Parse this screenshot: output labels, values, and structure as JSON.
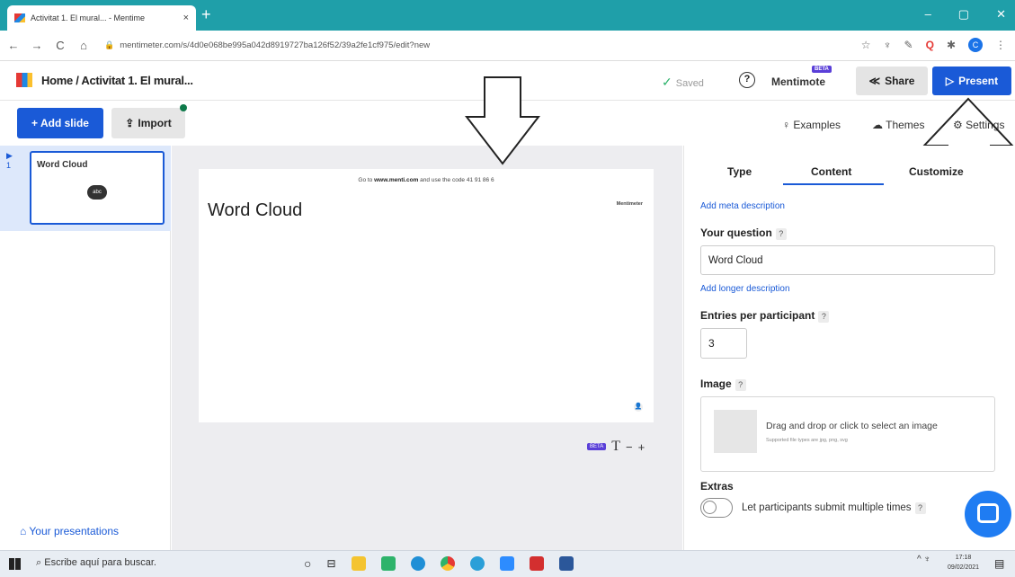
{
  "browser": {
    "tab_title": "Activitat 1. El mural... - Mentime",
    "tab_close": "×",
    "new_tab": "+",
    "window_controls": [
      "–",
      "▢",
      "✕"
    ],
    "nav": [
      "←",
      "→",
      "C",
      "⌂"
    ],
    "url": "mentimeter.com/s/4d0e068be995a042d8919727ba126f52/39a2fe1cf975/edit?new",
    "ext_icons": [
      "☆",
      "♆",
      "✎",
      "Q",
      "✱"
    ],
    "profile_initial": "C"
  },
  "header": {
    "breadcrumb": "Home / Activitat 1. El mural...",
    "saved": "Saved",
    "mentimote": "Mentimote",
    "mentimote_badge": "BETA",
    "share": "Share",
    "present": "Present"
  },
  "toolbar": {
    "add_slide": "+ Add slide",
    "import": "Import",
    "examples": "Examples",
    "themes": "Themes",
    "settings": "Settings"
  },
  "slides": [
    {
      "number": "1",
      "title": "Word Cloud"
    }
  ],
  "your_presentations": "Your presentations",
  "canvas": {
    "code_prefix": "Go to",
    "code_site": "www.menti.com",
    "code_mid": "and use the code",
    "code": "41 91 86 6",
    "title": "Word Cloud",
    "logo": "Mentimeter",
    "zoom_badge": "BETA",
    "zoom_text": "T",
    "zoom_out": "−",
    "zoom_in": "+"
  },
  "panel": {
    "tabs": [
      "Type",
      "Content",
      "Customize"
    ],
    "active_tab": "Content",
    "add_meta": "Add meta description",
    "question_label": "Your question",
    "question_value": "Word Cloud",
    "add_longer": "Add longer description",
    "entries_label": "Entries per participant",
    "entries_value": "3",
    "image_label": "Image",
    "drop_text": "Drag and drop or click to select an image",
    "drop_sub": "Supported file types are jpg, png, svg",
    "extras_label": "Extras",
    "toggle_label": "Let participants submit multiple times",
    "help_mark": "?"
  },
  "taskbar": {
    "search_placeholder": "Escribe aquí para buscar.",
    "time": "17:18",
    "date": "09/02/2021",
    "tray": "^ ♆"
  },
  "colors": {
    "chrome_teal": "#1f9fa9",
    "accent_blue": "#1a5ad7",
    "saved_green": "#2db36b",
    "chat_blue": "#1f7cf2"
  }
}
